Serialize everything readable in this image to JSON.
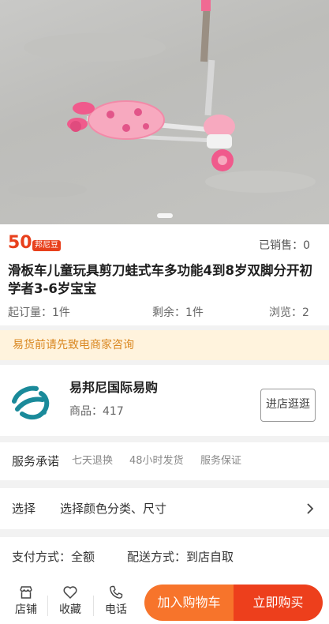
{
  "product": {
    "price": "50",
    "currency_badge": "邦尼豆",
    "sold_label": "已销售：0",
    "title": "滑板车儿童玩具剪刀蛙式车多功能4到8岁双脚分开初学者3-6岁宝宝",
    "min_order": "起订量：1件",
    "remaining": "剩余：1件",
    "views": "浏览：2"
  },
  "notice": "易货前请先致电商家咨询",
  "shop": {
    "name": "易邦尼国际易购",
    "goods_count": "商品：417",
    "enter_button": "进店逛逛"
  },
  "service": {
    "label": "服务承诺",
    "tags": [
      "七天退换",
      "48小时发货",
      "服务保证"
    ]
  },
  "select": {
    "label": "选择",
    "value": "选择颜色分类、尺寸"
  },
  "delivery": {
    "payment": "支付方式：全额",
    "shipping": "配送方式：到店自取"
  },
  "bottom_bar": {
    "shop": "店铺",
    "favorite": "收藏",
    "phone": "电话",
    "add_to_cart": "加入购物车",
    "buy_now": "立即购买"
  },
  "colors": {
    "accent_red": "#e8401c",
    "cart_orange": "#f7742b",
    "buy_red": "#ed3f1c",
    "notice_bg": "#fff3dd",
    "notice_text": "#d9861e",
    "logo_teal": "#1a8a9a"
  },
  "icons": {
    "shop": "store-icon",
    "favorite": "heart-icon",
    "phone": "phone-icon",
    "chevron": "chevron-right-icon"
  }
}
